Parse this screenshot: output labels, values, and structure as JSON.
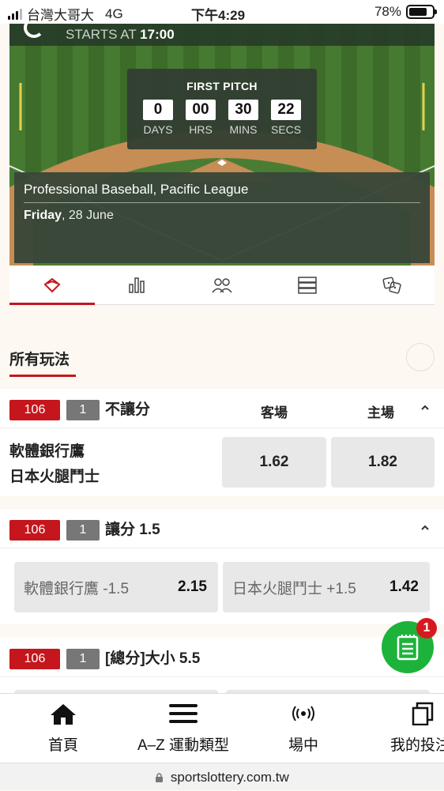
{
  "status_bar": {
    "carrier": "台灣大哥大",
    "network": "4G",
    "time": "下午4:29",
    "battery": "78%",
    "battery_level": 0.78
  },
  "event": {
    "starts_label": "STARTS AT",
    "starts_time": "17:00",
    "countdown": {
      "title": "FIRST PITCH",
      "days": "0",
      "hrs": "00",
      "mins": "30",
      "secs": "22",
      "days_label": "DAYS",
      "hrs_label": "HRS",
      "mins_label": "MINS",
      "secs_label": "SECS"
    },
    "league": "Professional Baseball, Pacific League",
    "day": "Friday",
    "date": ", 28 June"
  },
  "tabs": [
    {
      "icon": "baseball-field-icon",
      "active": true
    },
    {
      "icon": "stats-bars-icon",
      "active": false
    },
    {
      "icon": "team-people-icon",
      "active": false
    },
    {
      "icon": "list-table-icon",
      "active": false
    },
    {
      "icon": "dice-icon",
      "active": false
    }
  ],
  "section_title": "所有玩法",
  "markets": [
    {
      "code": "106",
      "num": "1",
      "title": "不讓分",
      "col_away": "客場",
      "col_home": "主場",
      "team_a": "軟體銀行鷹",
      "team_b": "日本火腿鬥士",
      "odd_away": "1.62",
      "odd_home": "1.82"
    },
    {
      "code": "106",
      "num": "1",
      "title": "讓分 1.5",
      "sel_a_name": "軟體銀行鷹 -1.5",
      "sel_a_odd": "2.15",
      "sel_b_name": "日本火腿鬥士 +1.5",
      "sel_b_odd": "1.42"
    },
    {
      "code": "106",
      "num": "1",
      "title": "[總分]大小 5.5"
    }
  ],
  "float_badge_count": "1",
  "bottom_nav": [
    {
      "label": "首頁",
      "icon": "home-icon"
    },
    {
      "label": "A–Z 運動類型",
      "icon": "menu-icon"
    },
    {
      "label": "場中",
      "icon": "live-broadcast-icon"
    },
    {
      "label": "我的投注",
      "icon": "betslip-copy-icon"
    }
  ],
  "url": "sportslottery.com.tw",
  "colors": {
    "accent_red": "#c4161c",
    "badge_gray": "#777777",
    "float_green": "#1db33a",
    "field_green": "#3d6b2b"
  }
}
